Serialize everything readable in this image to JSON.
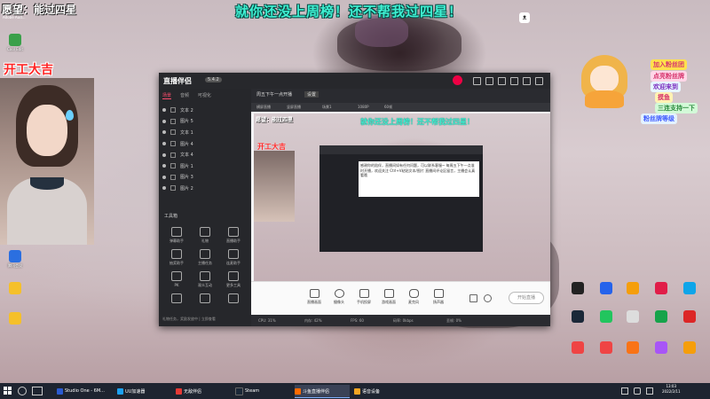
{
  "desktop": {
    "banner": "就你还没上周榜！还不帮我过四星！",
    "wish": "愿望：能过四星",
    "wish_sub": "Adobe Aud...",
    "kaigong": "开工大吉",
    "left_icons": [
      {
        "label": "Cool Edit",
        "color": "#3aa04a"
      },
      {
        "label": "腾讯会议",
        "color": "#2b6fe0"
      },
      {
        "label": "",
        "color": "#f5c02a"
      },
      {
        "label": "",
        "color": "#f5c02a"
      }
    ],
    "deco_texts": [
      "加入粉丝团",
      "点亮粉丝牌",
      "欢迎来到",
      "摸鱼",
      "三连支持一下",
      "粉丝牌等级"
    ]
  },
  "app": {
    "logo": "直播伴侣",
    "version": "5.4.2",
    "left_tabs": [
      "场景",
      "音频",
      "可视化"
    ],
    "scenes": [
      "文本 2",
      "图片 5",
      "文本 1",
      "图片 4",
      "文本 4",
      "图片 1",
      "图片 3",
      "图片 2"
    ],
    "tools_title": "工具箱",
    "tools": [
      "弹幕助手",
      "礼物",
      "直播助手",
      "抽奖助手",
      "主播任务",
      "连麦助手",
      "PK",
      "观众互动",
      "更多工具",
      "",
      "",
      ""
    ],
    "footer": "礼物任务，奖励发放中 | 立即查看",
    "preview_tabs": [
      "周五下午一点开播",
      "设置"
    ],
    "preview_sub": [
      "横屏直播",
      "竖屏直播",
      "场景1",
      "1080P",
      "60帧"
    ],
    "popup_text": "感谢你的陪伴，直播间如有任何问题，可以联系客服~ 每周五下午一点准时开播，欢迎关注 Ctrl+V粘贴文本/图片 直播间评论区留言，主播会认真看哦",
    "bottom_buttons": [
      "直播画面",
      "摄像头",
      "手机投屏",
      "游戏画面",
      "麦克风",
      "扬声器"
    ],
    "start_live": "开始直播",
    "status": [
      "CPU: 31%",
      "内存: 42%",
      "FPS: 60",
      "码率: 0kbps",
      "丢帧: 0%"
    ]
  },
  "taskbar": {
    "items": [
      {
        "label": "Studio One - 6M...",
        "color": "#2b5bd1",
        "active": false
      },
      {
        "label": "UU加速器",
        "color": "#1da1f2",
        "active": false
      },
      {
        "label": "无敌伴侣",
        "color": "#e53935",
        "active": false
      },
      {
        "label": "Steam",
        "color": "#1b2838",
        "active": false
      },
      {
        "label": "斗鱼直播伴侣",
        "color": "#ff6b00",
        "active": true
      },
      {
        "label": "语音设备",
        "color": "#f5a623",
        "active": false
      }
    ],
    "time": "13:03",
    "date": "2022/2/11"
  },
  "colors": {
    "banner": "#3ef0d2",
    "accent": "#ff4d6d",
    "taskbar": "#1e2430"
  }
}
